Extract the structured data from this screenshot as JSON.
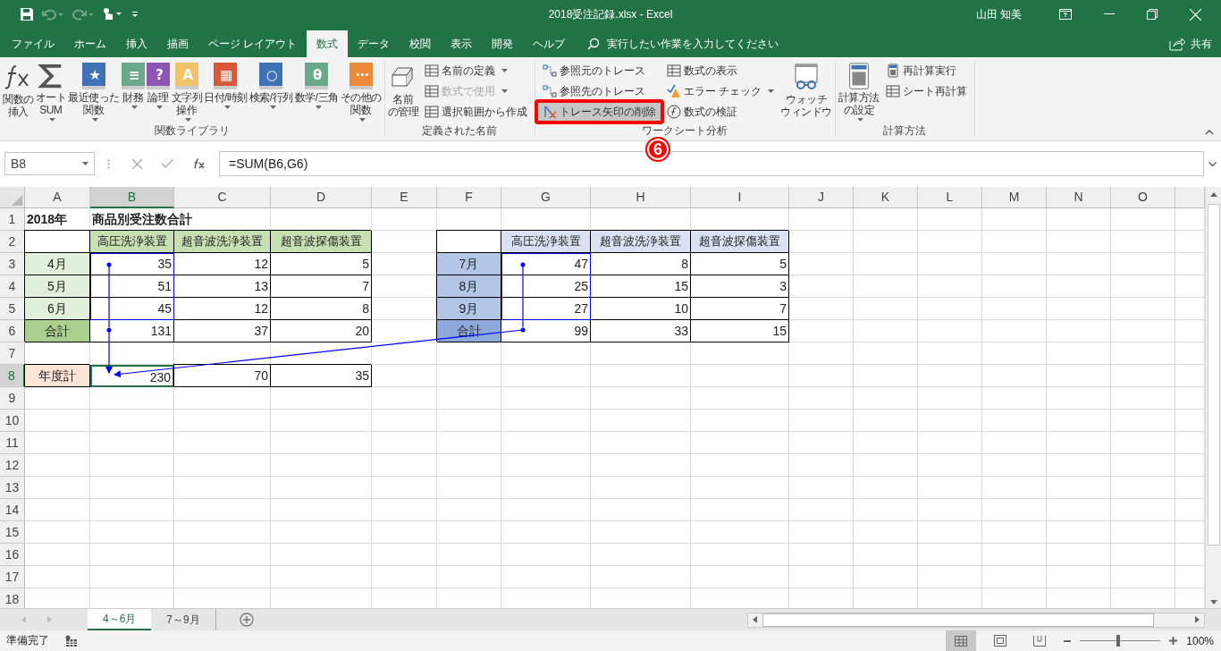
{
  "window": {
    "title": "2018受注記録.xlsx  -  Excel",
    "user": "山田 知美"
  },
  "tabs": [
    {
      "label": "ファイル",
      "selected": false
    },
    {
      "label": "ホーム",
      "selected": false
    },
    {
      "label": "挿入",
      "selected": false
    },
    {
      "label": "描画",
      "selected": false
    },
    {
      "label": "ページ レイアウト",
      "selected": false
    },
    {
      "label": "数式",
      "selected": true
    },
    {
      "label": "データ",
      "selected": false
    },
    {
      "label": "校閲",
      "selected": false
    },
    {
      "label": "表示",
      "selected": false
    },
    {
      "label": "開発",
      "selected": false
    },
    {
      "label": "ヘルプ",
      "selected": false
    }
  ],
  "tell_me": {
    "placeholder": "実行したい作業を入力してください"
  },
  "share": "共有",
  "ribbon": [
    {
      "label": "関数ライブラリ",
      "items": [
        {
          "kind": "fx",
          "lines": [
            "関数の",
            "挿入"
          ],
          "dropdown": false
        },
        {
          "kind": "sigma",
          "lines": [
            "オート",
            "SUM"
          ],
          "dropdown": true
        },
        {
          "kind": "book",
          "color": "#3f72b5",
          "glyph": "★",
          "lines": [
            "最近使った",
            "関数"
          ],
          "dropdown": true
        },
        {
          "kind": "book",
          "color": "#6aa88c",
          "glyph": "≡",
          "lines": [
            "財務"
          ],
          "dropdown": true
        },
        {
          "kind": "book",
          "color": "#8e55b5",
          "glyph": "?",
          "lines": [
            "論理"
          ],
          "dropdown": true
        },
        {
          "kind": "book",
          "color": "#f0c36a",
          "glyph": "A",
          "lines": [
            "文字列",
            "操作"
          ],
          "dropdown": true
        },
        {
          "kind": "book",
          "color": "#d9583b",
          "glyph": "▦",
          "lines": [
            "日付/時刻"
          ],
          "dropdown": true
        },
        {
          "kind": "book",
          "color": "#3f72b5",
          "glyph": "○",
          "lines": [
            "検索/行列"
          ],
          "dropdown": true
        },
        {
          "kind": "book",
          "color": "#6aa88c",
          "glyph": "θ",
          "lines": [
            "数学/三角"
          ],
          "dropdown": true
        },
        {
          "kind": "book",
          "color": "#ec8a3c",
          "glyph": "⋯",
          "lines": [
            "その他の",
            "関数"
          ],
          "dropdown": true
        }
      ]
    },
    {
      "label": "定義された名前",
      "items": [
        {
          "kind": "names",
          "lines": [
            "名前",
            "の管理"
          ],
          "dropdown": false
        },
        {
          "kind": "stack",
          "buttons": [
            {
              "kind": "define",
              "label": "名前の定義",
              "dropdown": true,
              "disabled": false,
              "highlighted": false
            },
            {
              "kind": "use",
              "label": "数式で使用",
              "dropdown": true,
              "disabled": true,
              "highlighted": false
            },
            {
              "kind": "create",
              "label": "選択範囲から作成",
              "dropdown": false,
              "disabled": false,
              "highlighted": false
            }
          ]
        }
      ]
    },
    {
      "label": "ワークシート分析",
      "items": [
        {
          "kind": "stack",
          "buttons": [
            {
              "kind": "precedents",
              "label": "参照元のトレース",
              "dropdown": false,
              "disabled": false,
              "highlighted": false
            },
            {
              "kind": "dependents",
              "label": "参照先のトレース",
              "dropdown": false,
              "disabled": false,
              "highlighted": false
            },
            {
              "kind": "remove",
              "label": "トレース矢印の削除",
              "dropdown": false,
              "disabled": false,
              "highlighted": true
            }
          ]
        },
        {
          "kind": "stack",
          "buttons": [
            {
              "kind": "show",
              "label": "数式の表示",
              "dropdown": false,
              "disabled": false,
              "highlighted": false
            },
            {
              "kind": "error",
              "label": "エラー チェック",
              "dropdown": true,
              "disabled": false,
              "highlighted": false
            },
            {
              "kind": "evaluate",
              "label": "数式の検証",
              "dropdown": false,
              "disabled": false,
              "highlighted": false
            }
          ]
        },
        {
          "kind": "watch",
          "lines": [
            "ウォッチ",
            "ウィンドウ"
          ],
          "dropdown": false
        }
      ]
    },
    {
      "label": "計算方法",
      "items": [
        {
          "kind": "calc",
          "lines": [
            "計算方法",
            "の設定"
          ],
          "dropdown": true
        },
        {
          "kind": "stack",
          "buttons": [
            {
              "kind": "calcnow",
              "label": "再計算実行",
              "dropdown": false,
              "disabled": false,
              "highlighted": false
            },
            {
              "kind": "calcsheet",
              "label": "シート再計算",
              "dropdown": false,
              "disabled": false,
              "highlighted": false
            }
          ]
        }
      ]
    }
  ],
  "annotation": "6",
  "formula_bar": {
    "name_box": "B8",
    "formula": "=SUM(B6,G6)"
  },
  "sheet": {
    "columns": [
      {
        "label": "A",
        "selected": false
      },
      {
        "label": "B",
        "selected": true
      },
      {
        "label": "C",
        "selected": false
      },
      {
        "label": "D",
        "selected": false
      },
      {
        "label": "E",
        "selected": false
      },
      {
        "label": "F",
        "selected": false
      },
      {
        "label": "G",
        "selected": false
      },
      {
        "label": "H",
        "selected": false
      },
      {
        "label": "I",
        "selected": false
      },
      {
        "label": "J",
        "selected": false
      },
      {
        "label": "K",
        "selected": false
      },
      {
        "label": "L",
        "selected": false
      },
      {
        "label": "M",
        "selected": false
      },
      {
        "label": "N",
        "selected": false
      },
      {
        "label": "O",
        "selected": false
      }
    ],
    "rows": [
      {
        "label": "1",
        "selected": false,
        "cells": [
          {
            "kind": "title",
            "text": "2018年"
          },
          {
            "kind": "title",
            "text": "商品別受注数合計"
          }
        ]
      },
      {
        "label": "2",
        "selected": false,
        "cells": [
          {
            "kind": "box"
          },
          {
            "kind": "head-green",
            "text": "高圧洗浄装置"
          },
          {
            "kind": "head-green",
            "text": "超音波洗浄装置"
          },
          {
            "kind": "head-green",
            "text": "超音波探傷装置"
          },
          {
            "kind": "blank"
          },
          {
            "kind": "box"
          },
          {
            "kind": "head-blue",
            "text": "高圧洗浄装置"
          },
          {
            "kind": "head-blue",
            "text": "超音波洗浄装置"
          },
          {
            "kind": "head-blue",
            "text": "超音波探傷装置"
          }
        ]
      },
      {
        "label": "3",
        "selected": false,
        "cells": [
          {
            "kind": "month-green",
            "text": "4月"
          },
          {
            "kind": "num",
            "text": "35"
          },
          {
            "kind": "num",
            "text": "12"
          },
          {
            "kind": "num",
            "text": "5"
          },
          {
            "kind": "blank"
          },
          {
            "kind": "month-blue",
            "text": "7月"
          },
          {
            "kind": "num",
            "text": "47"
          },
          {
            "kind": "num",
            "text": "8"
          },
          {
            "kind": "num",
            "text": "5"
          }
        ]
      },
      {
        "label": "4",
        "selected": false,
        "cells": [
          {
            "kind": "month-green",
            "text": "5月"
          },
          {
            "kind": "num",
            "text": "51"
          },
          {
            "kind": "num",
            "text": "13"
          },
          {
            "kind": "num",
            "text": "7"
          },
          {
            "kind": "blank"
          },
          {
            "kind": "month-blue",
            "text": "8月"
          },
          {
            "kind": "num",
            "text": "25"
          },
          {
            "kind": "num",
            "text": "15"
          },
          {
            "kind": "num",
            "text": "3"
          }
        ]
      },
      {
        "label": "5",
        "selected": false,
        "cells": [
          {
            "kind": "month-green",
            "text": "6月"
          },
          {
            "kind": "num",
            "text": "45"
          },
          {
            "kind": "num",
            "text": "12"
          },
          {
            "kind": "num",
            "text": "8"
          },
          {
            "kind": "blank"
          },
          {
            "kind": "month-blue",
            "text": "9月"
          },
          {
            "kind": "num",
            "text": "27"
          },
          {
            "kind": "num",
            "text": "10"
          },
          {
            "kind": "num",
            "text": "7"
          }
        ]
      },
      {
        "label": "6",
        "selected": false,
        "cells": [
          {
            "kind": "total-green",
            "text": "合計"
          },
          {
            "kind": "num",
            "text": "131"
          },
          {
            "kind": "num",
            "text": "37"
          },
          {
            "kind": "num",
            "text": "20"
          },
          {
            "kind": "blank"
          },
          {
            "kind": "total-blue",
            "text": "合計"
          },
          {
            "kind": "num",
            "text": "99"
          },
          {
            "kind": "num",
            "text": "33"
          },
          {
            "kind": "num",
            "text": "15"
          }
        ]
      },
      {
        "label": "7",
        "selected": false
      },
      {
        "label": "8",
        "selected": true,
        "cells": [
          {
            "kind": "annual",
            "text": "年度計"
          },
          {
            "kind": "active",
            "text": "230"
          },
          {
            "kind": "num",
            "text": "70"
          },
          {
            "kind": "num",
            "text": "35"
          }
        ]
      },
      {
        "label": "9",
        "selected": false
      },
      {
        "label": "10",
        "selected": false
      },
      {
        "label": "11",
        "selected": false
      },
      {
        "label": "12",
        "selected": false
      },
      {
        "label": "13",
        "selected": false
      },
      {
        "label": "14",
        "selected": false
      },
      {
        "label": "15",
        "selected": false
      },
      {
        "label": "16",
        "selected": false
      },
      {
        "label": "17",
        "selected": false
      },
      {
        "label": "18",
        "selected": false
      }
    ]
  },
  "sheet_tabs": [
    {
      "label": "4～6月",
      "selected": true
    },
    {
      "label": "7～9月",
      "selected": false
    }
  ],
  "status_bar": {
    "text": "準備完了",
    "views": [
      {
        "kind": "normal",
        "selected": true
      },
      {
        "kind": "layout",
        "selected": false
      },
      {
        "kind": "break",
        "selected": false
      }
    ],
    "zoom": {
      "level": 0.48,
      "reading": "100%"
    }
  }
}
